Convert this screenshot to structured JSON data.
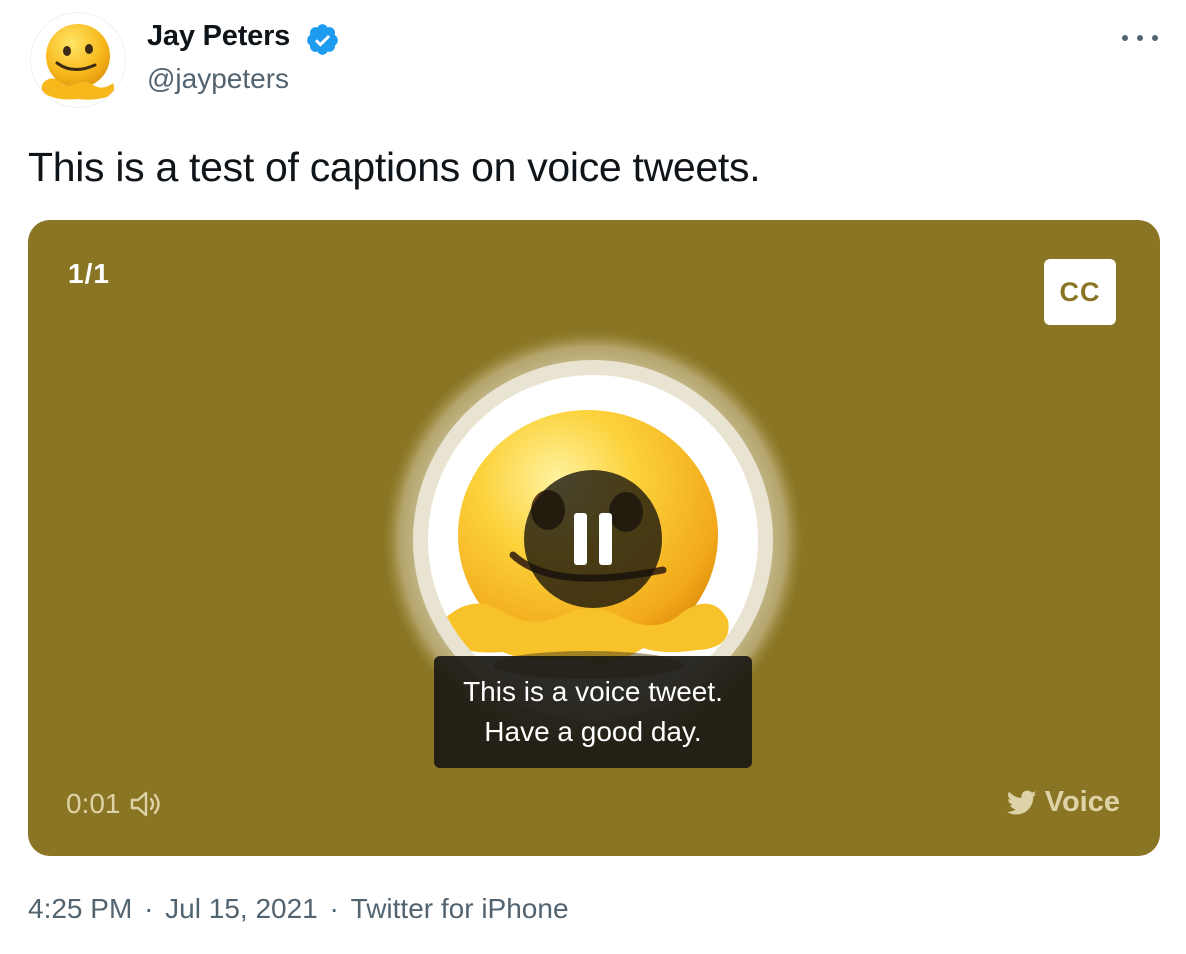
{
  "author": {
    "display_name": "Jay Peters",
    "handle": "@jaypeters",
    "avatar_icon": "melting-face-emoji",
    "verified_icon": "verified-badge-icon"
  },
  "tweet": {
    "text": "This is a test of captions on voice tweets.",
    "more_icon": "more-options-icon"
  },
  "voice_card": {
    "background_color": "#8a7524",
    "counter": "1/1",
    "cc_label": "CC",
    "caption_lines": [
      "This is a voice tweet.",
      "Have a good day."
    ],
    "elapsed": "0:01",
    "brand_label": "Voice",
    "play_state": "paused-icon-shown"
  },
  "meta": {
    "time": "4:25 PM",
    "date": "Jul 15, 2021",
    "source": "Twitter for iPhone",
    "separator": "·"
  }
}
